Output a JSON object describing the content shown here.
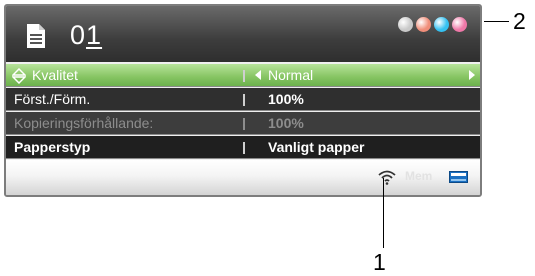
{
  "header": {
    "copies_prefix": "0",
    "copies_cursor": "1"
  },
  "ink_colors": [
    "#c9c9c9",
    "#f08e7a",
    "#35c1f2",
    "#ef78a8"
  ],
  "menu": [
    {
      "label": "Kvalitet",
      "value": "Normal"
    },
    {
      "label": "Först./Förm.",
      "value": "100%"
    },
    {
      "label": "Kopieringsförhållande:",
      "value": "100%"
    },
    {
      "label": "Papperstyp",
      "value": "Vanligt papper"
    }
  ],
  "status": {
    "memory_label": "Mem"
  },
  "callouts": {
    "one": "1",
    "two": "2"
  }
}
